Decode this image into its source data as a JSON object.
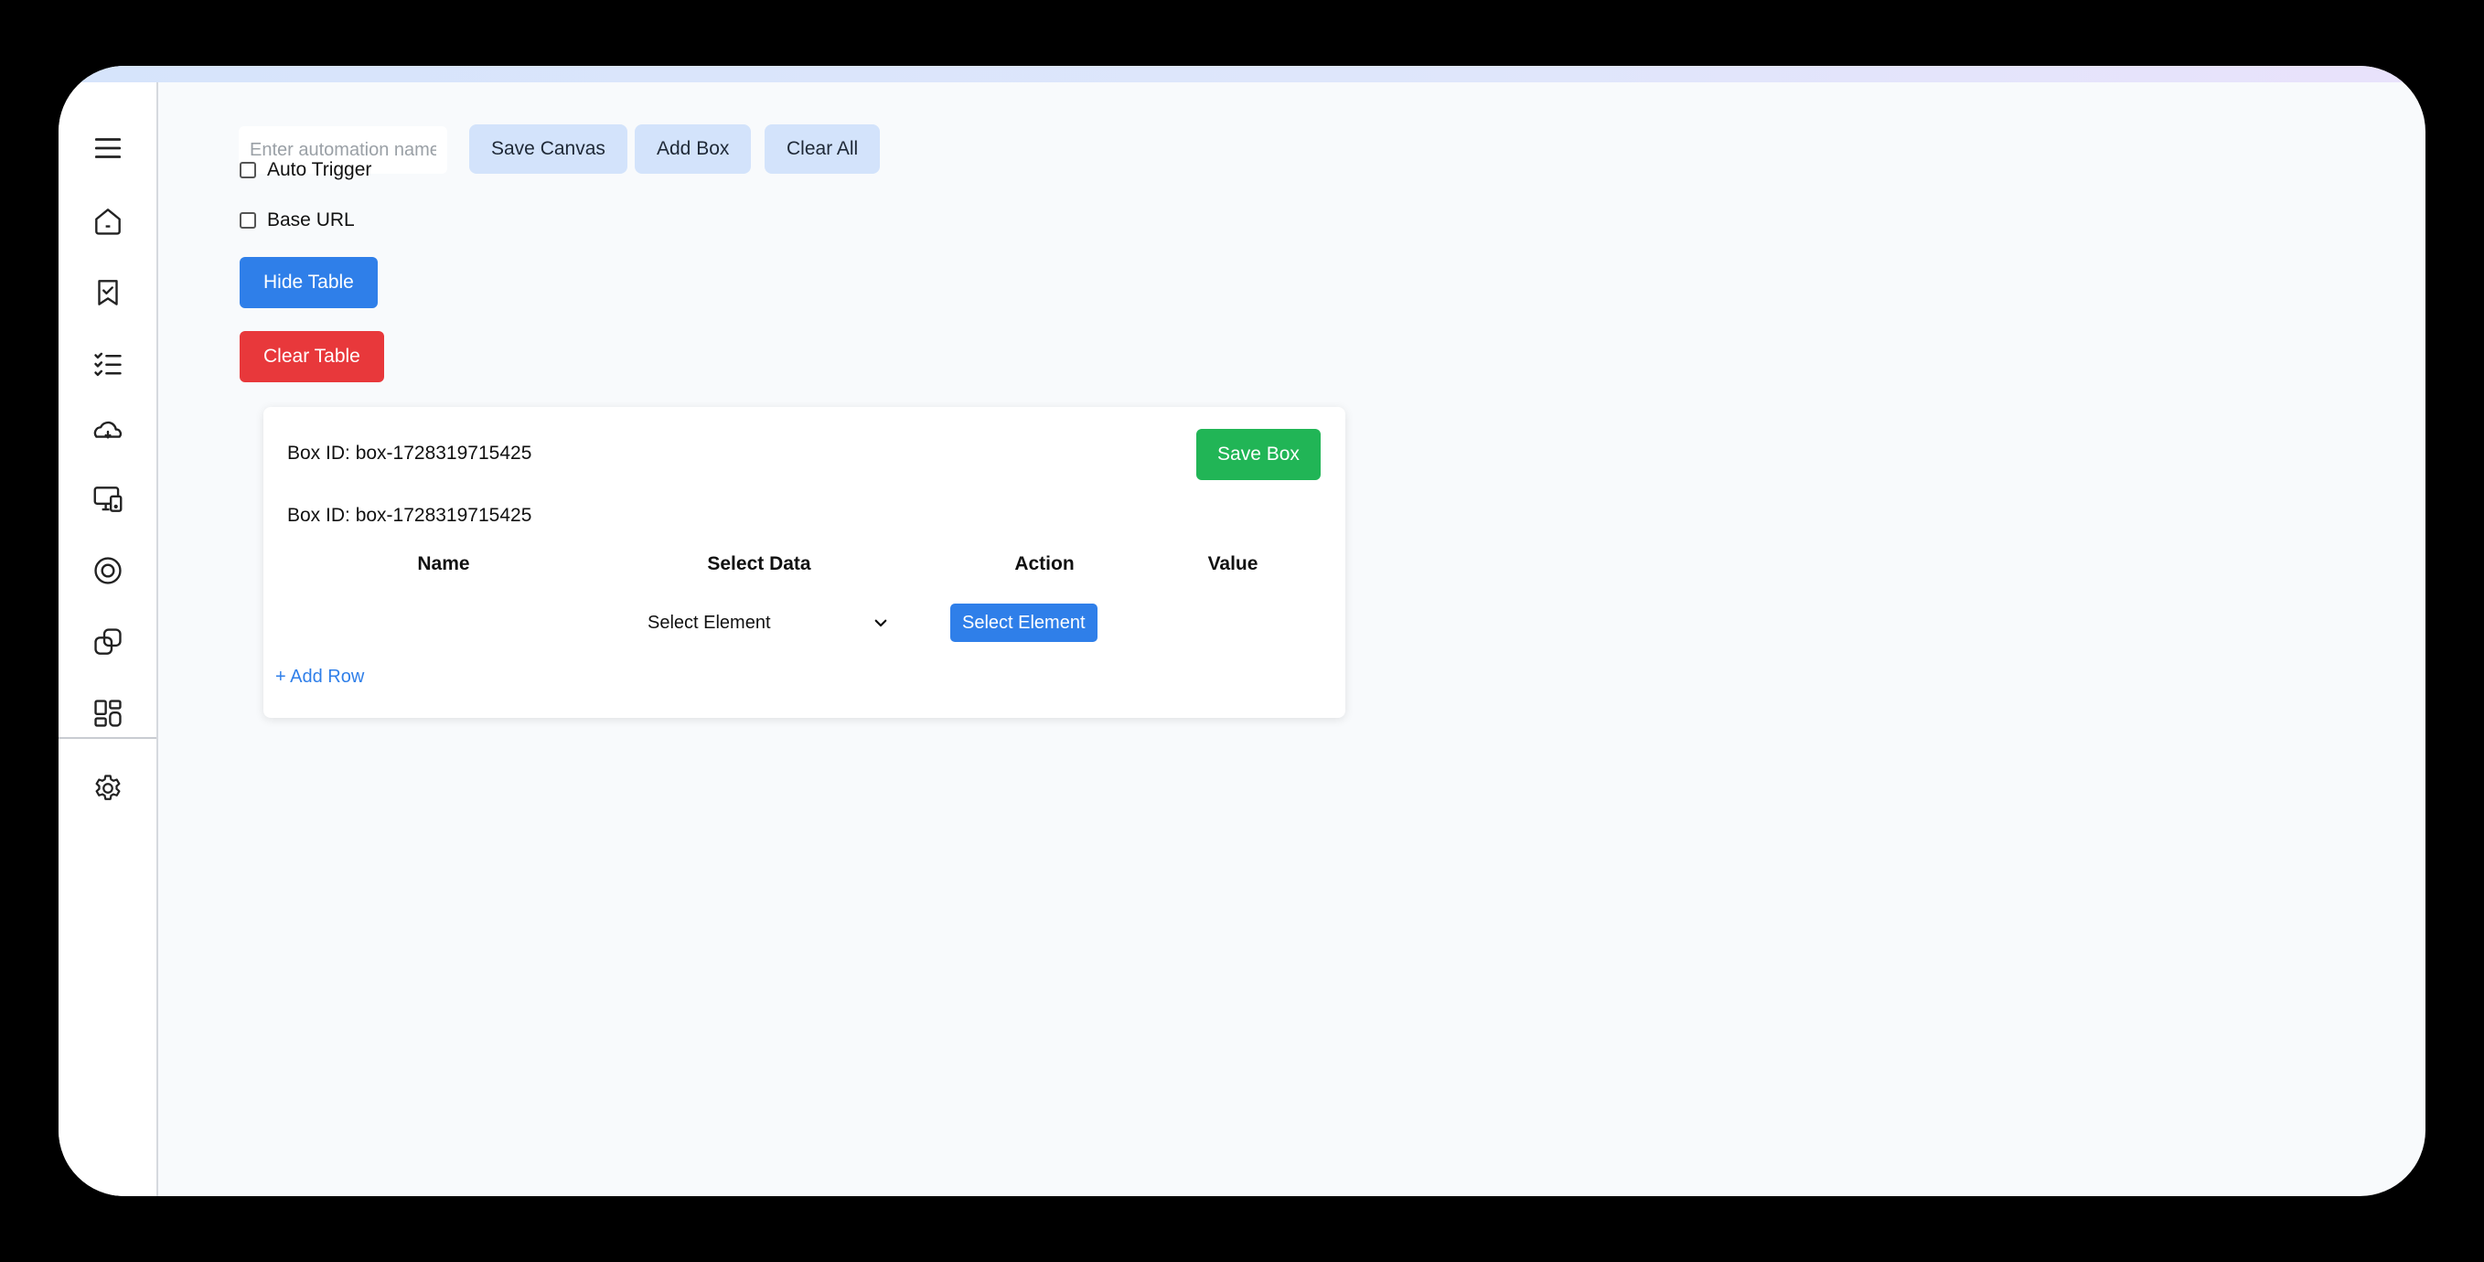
{
  "toolbar": {
    "name_placeholder": "Enter automation name",
    "save_canvas": "Save Canvas",
    "add_box": "Add Box",
    "clear_all": "Clear All"
  },
  "options": {
    "auto_trigger": "Auto Trigger",
    "base_url": "Base URL"
  },
  "actions": {
    "hide_table": "Hide Table",
    "clear_table": "Clear Table"
  },
  "box": {
    "id_label_1": "Box ID: box-1728319715425",
    "id_label_2": "Box ID: box-1728319715425",
    "save_box": "Save Box",
    "columns": [
      "Name",
      "Select Data",
      "Action",
      "Value"
    ],
    "row": {
      "select_value": "Select Element",
      "action_button": "Select Element"
    },
    "add_row": "+ Add Row"
  },
  "sidebar": {
    "icons": [
      "menu-icon",
      "home-icon",
      "bookmark-check-icon",
      "checklist-icon",
      "cloud-icon",
      "devices-icon",
      "target-icon",
      "shapes-icon",
      "dashboard-icon",
      "gear-icon"
    ]
  },
  "colors": {
    "primary": "#2f7fe9",
    "danger": "#e8383b",
    "success": "#21b556",
    "toolbar_button": "#d3e3fb"
  }
}
